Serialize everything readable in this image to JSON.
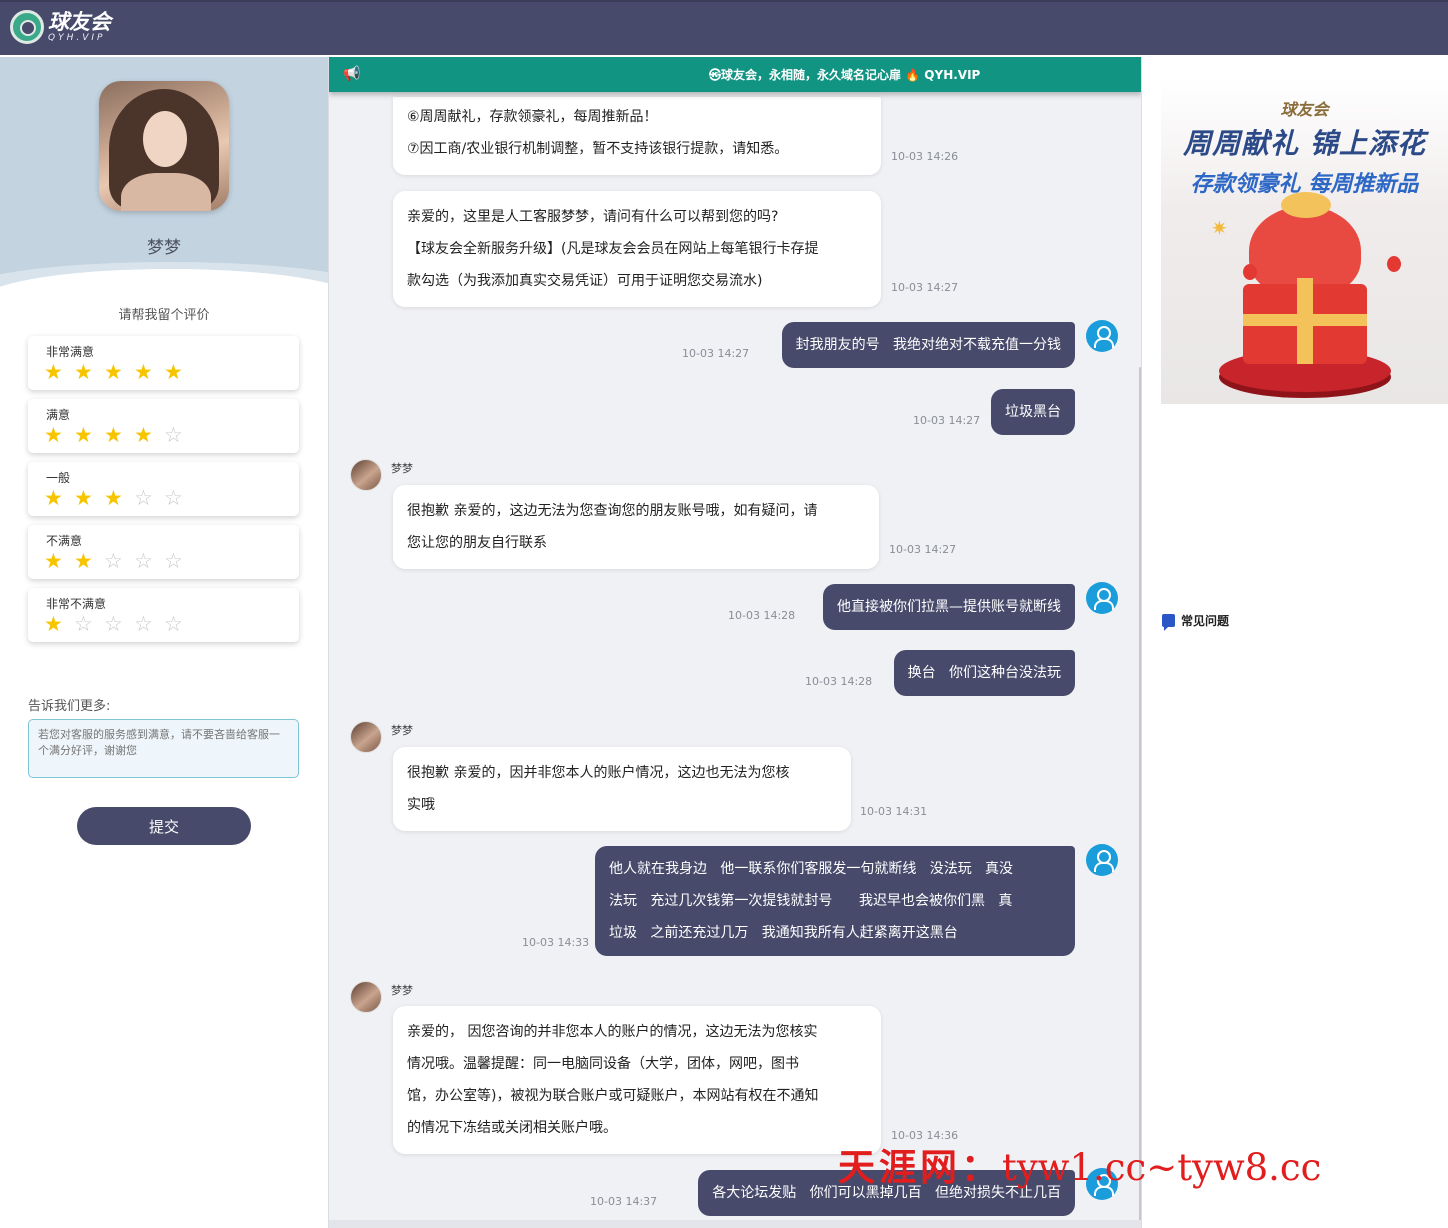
{
  "header": {
    "logo_title": "球友会",
    "logo_sub": "QYH.VIP"
  },
  "agent": {
    "name": "梦梦"
  },
  "rating": {
    "title": "请帮我留个评价",
    "options": [
      {
        "label": "非常满意",
        "stars": 5
      },
      {
        "label": "满意",
        "stars": 4
      },
      {
        "label": "一般",
        "stars": 3
      },
      {
        "label": "不满意",
        "stars": 2
      },
      {
        "label": "非常不满意",
        "stars": 1
      }
    ],
    "max_stars": 5,
    "more_label": "告诉我们更多:",
    "more_placeholder": "若您对客服的服务感到满意，请不要吝啬给客服一个满分好评，谢谢您",
    "submit_label": "提交"
  },
  "chat": {
    "notice": "㉿球友会，永相随，永久域名记心扉 🔥 QYH.VIP",
    "agent_label": "梦梦",
    "messages": [
      {
        "from": "agent",
        "lines": [
          "⑥周周献礼，存款领豪礼，每周推新品！",
          "⑦因工商/农业银行机制调整，暂不支持该银行提款，请知悉。"
        ],
        "time": "10-03 14:26"
      },
      {
        "from": "agent",
        "lines": [
          "亲爱的，这里是人工客服梦梦，请问有什么可以帮到您的吗?",
          "【球友会全新服务升级】(凡是球友会会员在网站上每笔银行卡存提",
          "款勾选（为我添加真实交易凭证）可用于证明您交易流水)"
        ],
        "time": "10-03 14:27"
      },
      {
        "from": "user",
        "text": "封我朋友的号   我绝对绝对不载充值一分钱",
        "time": "10-03 14:27"
      },
      {
        "from": "user",
        "text": "垃圾黑台",
        "time": "10-03 14:27"
      },
      {
        "from": "agent",
        "lines": [
          "很抱歉 亲爱的，这边无法为您查询您的朋友账号哦，如有疑问，请",
          "您让您的朋友自行联系"
        ],
        "time": "10-03 14:27"
      },
      {
        "from": "user",
        "text": "他直接被你们拉黑—提供账号就断线",
        "time": "10-03 14:28"
      },
      {
        "from": "user",
        "text": "换台   你们这种台没法玩",
        "time": "10-03 14:28"
      },
      {
        "from": "agent",
        "lines": [
          "很抱歉 亲爱的，因并非您本人的账户情况，这边也无法为您核",
          "实哦"
        ],
        "time": "10-03 14:31"
      },
      {
        "from": "user",
        "text": "他人就在我身边   他一联系你们客服发一句就断线   没法玩   真没\n法玩   充过几次钱第一次提钱就封号      我迟早也会被你们黑   真\n垃圾   之前还充过几万   我通知我所有人赶紧离开这黑台",
        "time": "10-03 14:33"
      },
      {
        "from": "agent",
        "lines": [
          "亲爱的， 因您咨询的并非您本人的账户的情况，这边无法为您核实",
          "情况哦。温馨提醒：同一电脑同设备（大学，团体，网吧，图书",
          "馆，办公室等)，被视为联合账户或可疑账户，本网站有权在不通知",
          "的情况下冻结或关闭相关账户哦。"
        ],
        "time": "10-03 14:36"
      },
      {
        "from": "user",
        "text": "各大论坛发贴   你们可以黑掉几百   但绝对损失不止几百",
        "time": "10-03 14:37"
      }
    ]
  },
  "banner": {
    "brand": "球友会",
    "headline": "周周献礼 锦上添花",
    "subline": "存款领豪礼 每周推新品"
  },
  "faq": {
    "label": "常见问题"
  },
  "watermark": {
    "cn": "天涯网：",
    "url": "tyw1.cc~tyw8.cc"
  },
  "colors": {
    "header_bg": "#474a6b",
    "notice_bg": "#129483",
    "user_bubble": "#474a6b",
    "star_on": "#f6c500",
    "user_avatar": "#1b9ddc"
  }
}
